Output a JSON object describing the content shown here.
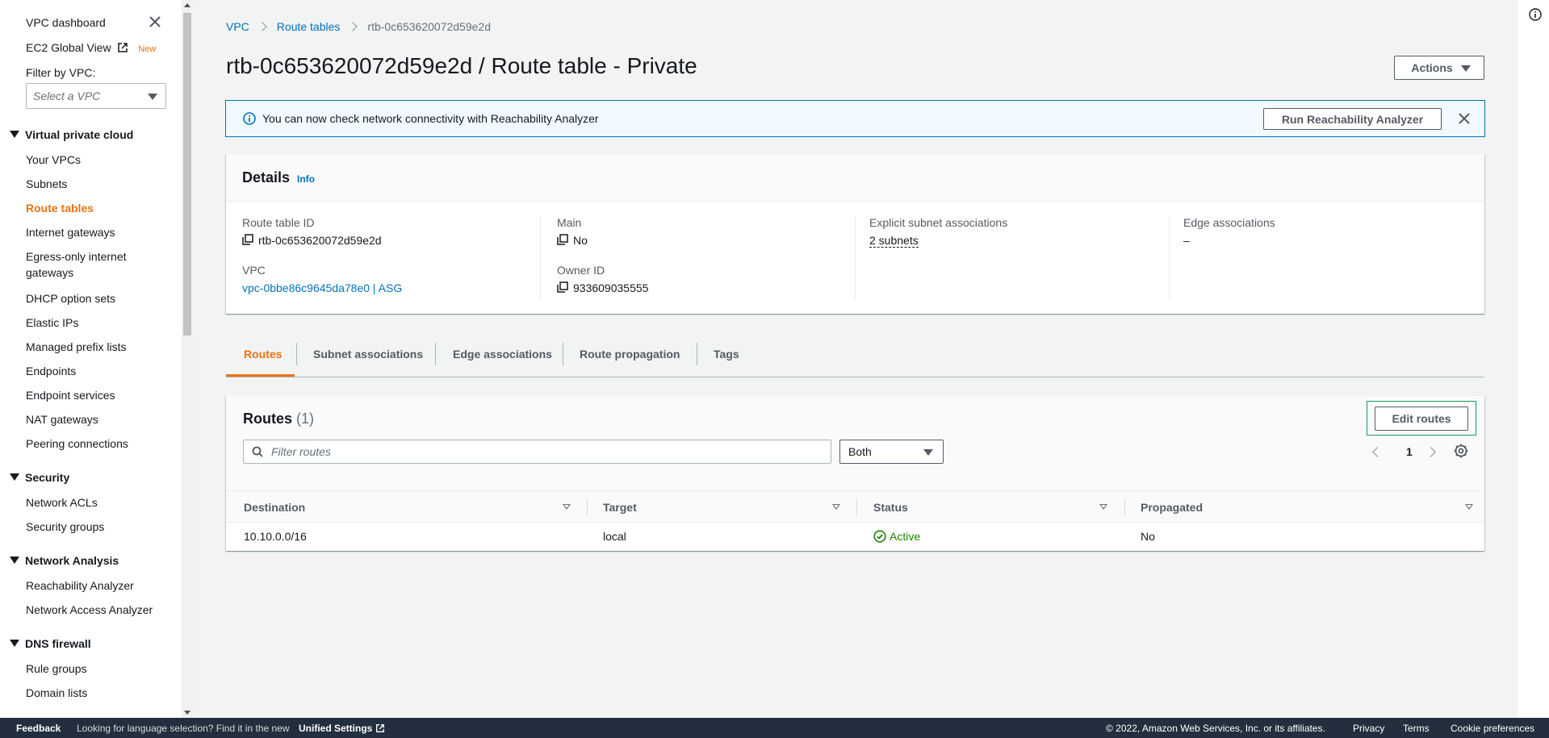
{
  "sidebar": {
    "dashboard": "VPC dashboard",
    "ec2_global_view": "EC2 Global View",
    "new_badge": "New",
    "filter_label": "Filter by VPC:",
    "filter_placeholder": "Select a VPC",
    "sections": [
      {
        "title": "Virtual private cloud",
        "items": [
          "Your VPCs",
          "Subnets",
          "Route tables",
          "Internet gateways",
          "Egress-only internet",
          "gateways",
          "DHCP option sets",
          "Elastic IPs",
          "Managed prefix lists",
          "Endpoints",
          "Endpoint services",
          "NAT gateways",
          "Peering connections"
        ]
      },
      {
        "title": "Security",
        "items": [
          "Network ACLs",
          "Security groups"
        ]
      },
      {
        "title": "Network Analysis",
        "items": [
          "Reachability Analyzer",
          "Network Access Analyzer"
        ]
      },
      {
        "title": "DNS firewall",
        "items": [
          "Rule groups",
          "Domain lists"
        ]
      }
    ],
    "active_item": "Route tables"
  },
  "breadcrumb": {
    "vpc": "VPC",
    "route_tables": "Route tables",
    "current": "rtb-0c653620072d59e2d"
  },
  "page": {
    "title": "rtb-0c653620072d59e2d / Route table - Private",
    "actions_label": "Actions"
  },
  "flash": {
    "text": "You can now check network connectivity with Reachability Analyzer",
    "button": "Run Reachability Analyzer"
  },
  "details": {
    "title": "Details",
    "info": "Info",
    "route_table_id_label": "Route table ID",
    "route_table_id": "rtb-0c653620072d59e2d",
    "vpc_label": "VPC",
    "vpc_value": "vpc-0bbe86c9645da78e0 | ASG",
    "main_label": "Main",
    "main_value": "No",
    "owner_label": "Owner ID",
    "owner_value": "933609035555",
    "explicit_label": "Explicit subnet associations",
    "explicit_value": "2 subnets",
    "edge_label": "Edge associations",
    "edge_value": "–"
  },
  "tabs": [
    "Routes",
    "Subnet associations",
    "Edge associations",
    "Route propagation",
    "Tags"
  ],
  "routes": {
    "title": "Routes",
    "count": "(1)",
    "edit_button": "Edit routes",
    "filter_placeholder": "Filter routes",
    "filter_select": "Both",
    "page": "1",
    "columns": [
      "Destination",
      "Target",
      "Status",
      "Propagated"
    ],
    "rows": [
      {
        "destination": "10.10.0.0/16",
        "target": "local",
        "status": "Active",
        "propagated": "No"
      }
    ]
  },
  "footer": {
    "feedback": "Feedback",
    "lang_note": "Looking for language selection? Find it in the new",
    "unified_settings": "Unified Settings",
    "copyright": "© 2022, Amazon Web Services, Inc. or its affiliates.",
    "privacy": "Privacy",
    "terms": "Terms",
    "cookies": "Cookie preferences"
  },
  "colors": {
    "accent": "#ec7211",
    "link": "#0073bb",
    "success": "#1d8102",
    "footer": "#232f3e"
  }
}
